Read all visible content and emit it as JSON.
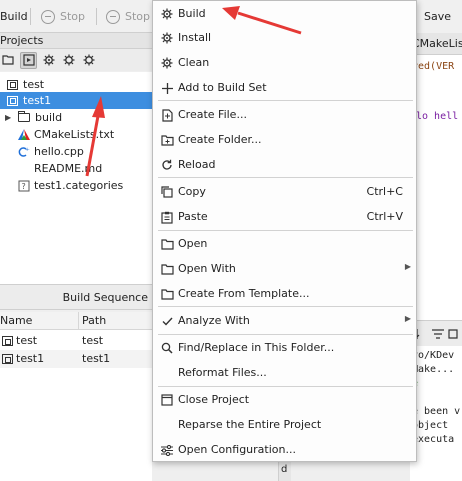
{
  "toolbar": {
    "build_label": "Build",
    "stop_label": "Stop",
    "stop_all_label": "Stop A",
    "save_label": "Save"
  },
  "projects": {
    "title": "Projects",
    "tree": [
      {
        "label": "test",
        "kind": "project",
        "selected": false
      },
      {
        "label": "test1",
        "kind": "project",
        "selected": true
      },
      {
        "label": "build",
        "kind": "folder",
        "expander": "▶"
      },
      {
        "label": "CMakeLists.txt",
        "kind": "cmake-file"
      },
      {
        "label": "hello.cpp",
        "kind": "cpp-file"
      },
      {
        "label": "README.md",
        "kind": "text-file"
      },
      {
        "label": "test1.categories",
        "kind": "unknown-file"
      }
    ]
  },
  "build_sequence": {
    "title": "Build Sequence",
    "columns": [
      "Name",
      "Path"
    ],
    "rows": [
      {
        "name": "test",
        "path": "test"
      },
      {
        "name": "test1",
        "path": "test1"
      }
    ]
  },
  "editor": {
    "tab_label": "CMakeLists.t",
    "lines": [
      {
        "text": "red(VER",
        "color": "#8b4513"
      },
      {
        "text": "",
        "color": "#1f1f1f"
      },
      {
        "text": "",
        "color": "#1f1f1f"
      },
      {
        "text": "lo hell",
        "color": "#7a1fa2"
      }
    ]
  },
  "output": {
    "lines": [
      {
        "text": "vo/KDev",
        "color": "#1f1f1f"
      },
      {
        "text": "Make...",
        "color": "#1f1f1f"
      },
      {
        "text": "e",
        "color": "#2c8a2c"
      },
      {
        "text": "",
        "color": "#1f1f1f"
      },
      {
        "text": "e been v",
        "color": "#1f1f1f"
      },
      {
        "text": " object",
        "color": "#1f1f1f"
      },
      {
        "text": "executa",
        "color": "#1f1f1f"
      }
    ],
    "vertical_tab_label": "d"
  },
  "context_menu": {
    "items": [
      {
        "label": "Build",
        "icon": "gear-icon"
      },
      {
        "label": "Install",
        "icon": "gear-icon"
      },
      {
        "label": "Clean",
        "icon": "gear-icon"
      },
      {
        "label": "Add to Build Set",
        "icon": "plus-icon"
      },
      {
        "label": "Create File...",
        "icon": "new-file-icon"
      },
      {
        "label": "Create Folder...",
        "icon": "new-folder-icon"
      },
      {
        "label": "Reload",
        "icon": "reload-icon"
      },
      {
        "label": "Copy",
        "icon": "copy-icon",
        "shortcut": "Ctrl+C"
      },
      {
        "label": "Paste",
        "icon": "paste-icon",
        "shortcut": "Ctrl+V"
      },
      {
        "label": "Open",
        "icon": "folder-icon"
      },
      {
        "label": "Open With",
        "icon": "folder-icon",
        "submenu": true
      },
      {
        "label": "Create From Template...",
        "icon": "folder-icon"
      },
      {
        "label": "Analyze With",
        "icon": "check-icon",
        "submenu": true
      },
      {
        "label": "Find/Replace in This Folder...",
        "icon": "search-icon"
      },
      {
        "label": "Reformat Files...",
        "icon": ""
      },
      {
        "label": "Close Project",
        "icon": "close-project-icon"
      },
      {
        "label": "Reparse the Entire Project",
        "icon": ""
      },
      {
        "label": "Open Configuration...",
        "icon": "configure-icon"
      }
    ]
  },
  "annotation_color": "#e53935"
}
